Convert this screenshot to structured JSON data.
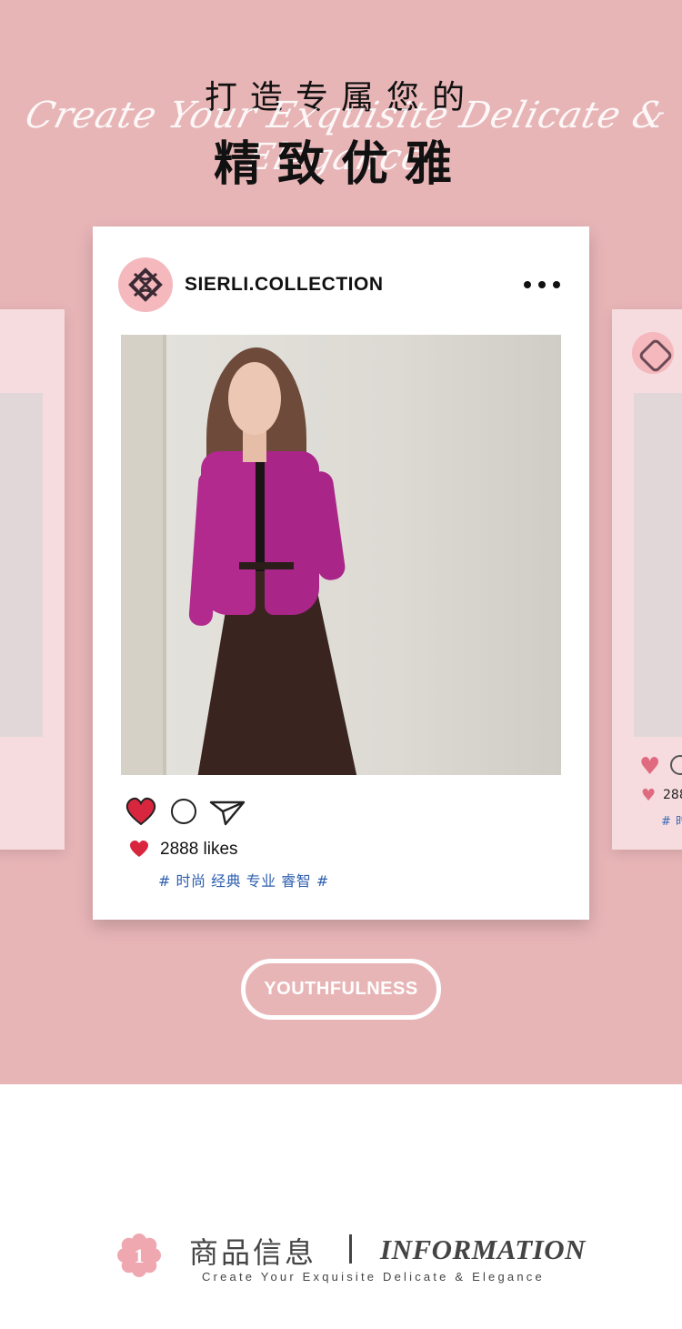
{
  "hero": {
    "title_line1": "打造专属您的",
    "script_text": "Create Your Exquisite Delicate & Elegance",
    "title_line2": "精致优雅",
    "background_color": "#e8b5b7"
  },
  "post": {
    "account_name": "SIERLI.COLLECTION",
    "more_icon": "more-dots-icon",
    "likes": "2888 likes",
    "tags": "# 时尚 经典 专业 睿智 #",
    "actions": [
      "heart-icon",
      "comment-icon",
      "send-icon"
    ]
  },
  "side_post": {
    "likes_partial": "288",
    "tags_partial": "# 时"
  },
  "badge": {
    "label": "YOUTHFULNESS"
  },
  "info": {
    "number": "1",
    "title_cn": "商品信息",
    "title_en": "INFORMATION",
    "subtitle": "Create Your Exquisite Delicate & Elegance"
  },
  "colors": {
    "accent_pink": "#e8b5b7",
    "heart_red": "#d9263f",
    "tag_blue": "#2f5fb0"
  }
}
